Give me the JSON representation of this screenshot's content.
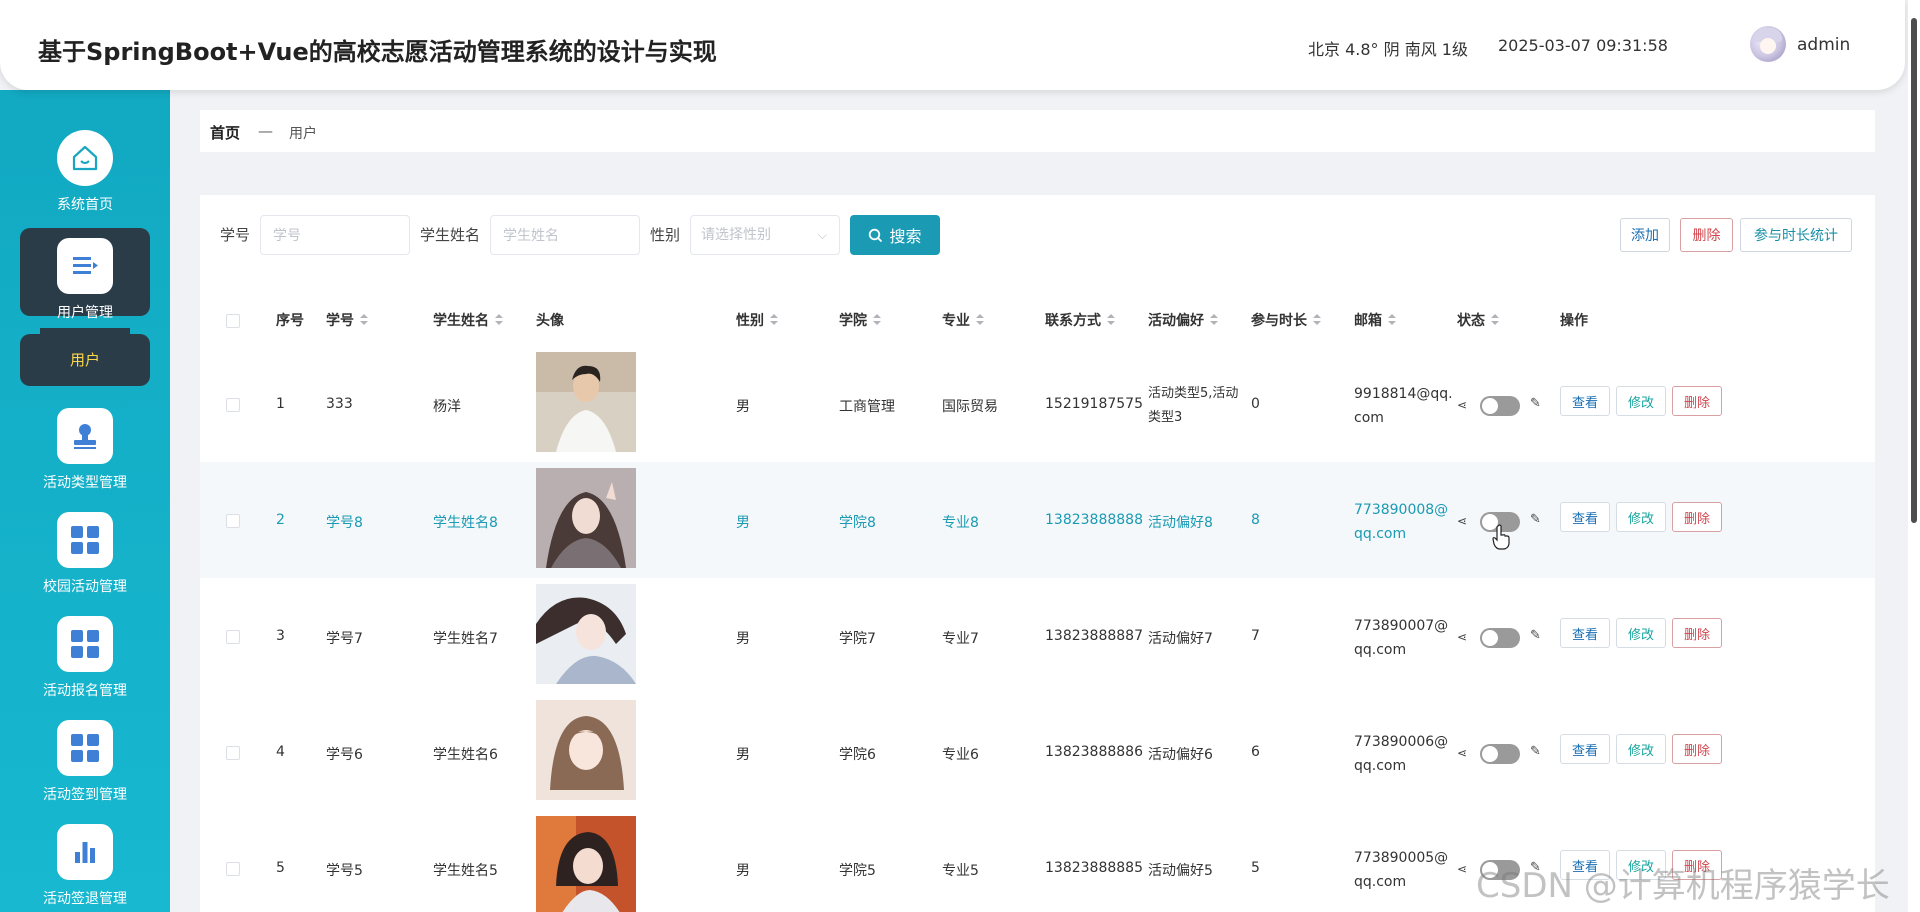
{
  "header": {
    "title": "基于SpringBoot+Vue的高校志愿活动管理系统的设计与实现",
    "weather": "北京  4.8°  阴  南风  1级",
    "datetime": "2025-03-07 09:31:58",
    "username": "admin"
  },
  "sidebar": {
    "items": [
      {
        "label": "系统首页",
        "icon": "home-icon"
      },
      {
        "label": "用户管理",
        "icon": "user-list-icon"
      },
      {
        "label": "活动类型管理",
        "icon": "stamp-icon"
      },
      {
        "label": "校园活动管理",
        "icon": "grid-icon"
      },
      {
        "label": "活动报名管理",
        "icon": "grid-icon"
      },
      {
        "label": "活动签到管理",
        "icon": "grid-icon"
      },
      {
        "label": "活动签退管理",
        "icon": "bar-chart-icon"
      }
    ],
    "submenu_label": "用户"
  },
  "breadcrumb": {
    "home": "首页",
    "separator": "—",
    "current": "用户"
  },
  "search": {
    "student_no_label": "学号",
    "student_no_placeholder": "学号",
    "student_name_label": "学生姓名",
    "student_name_placeholder": "学生姓名",
    "gender_label": "性别",
    "gender_placeholder": "请选择性别",
    "button_label": "搜索"
  },
  "actions": {
    "add": "添加",
    "delete": "删除",
    "stats": "参与时长统计"
  },
  "table": {
    "columns": [
      "序号",
      "学号",
      "学生姓名",
      "头像",
      "性别",
      "学院",
      "专业",
      "联系方式",
      "活动偏好",
      "参与时长",
      "邮箱",
      "状态",
      "操作"
    ],
    "rows": [
      {
        "index": "1",
        "student_no": "333",
        "name": "杨洋",
        "gender": "男",
        "college": "工商管理",
        "major": "国际贸易",
        "phone": "15219187575",
        "hobby": "活动类型5,活动类型3",
        "duration": "0",
        "email": "9918814@qq.com"
      },
      {
        "index": "2",
        "student_no": "学号8",
        "name": "学生姓名8",
        "gender": "男",
        "college": "学院8",
        "major": "专业8",
        "phone": "13823888888",
        "hobby": "活动偏好8",
        "duration": "8",
        "email": "773890008@qq.com"
      },
      {
        "index": "3",
        "student_no": "学号7",
        "name": "学生姓名7",
        "gender": "男",
        "college": "学院7",
        "major": "专业7",
        "phone": "13823888887",
        "hobby": "活动偏好7",
        "duration": "7",
        "email": "773890007@qq.com"
      },
      {
        "index": "4",
        "student_no": "学号6",
        "name": "学生姓名6",
        "gender": "男",
        "college": "学院6",
        "major": "专业6",
        "phone": "13823888886",
        "hobby": "活动偏好6",
        "duration": "6",
        "email": "773890006@qq.com"
      },
      {
        "index": "5",
        "student_no": "学号5",
        "name": "学生姓名5",
        "gender": "男",
        "college": "学院5",
        "major": "专业5",
        "phone": "13823888885",
        "hobby": "活动偏好5",
        "duration": "5",
        "email": "773890005@qq.com"
      }
    ],
    "row_actions": {
      "view": "查看",
      "edit": "修改",
      "delete": "删除"
    }
  },
  "watermark": "CSDN @计算机程序猿学长",
  "colors": {
    "sidebar": "#12a9c2",
    "accent": "#1a9ab3",
    "active_nav": "#2a3c48",
    "submenu_text": "#ffd84a",
    "danger": "#d0454c"
  }
}
